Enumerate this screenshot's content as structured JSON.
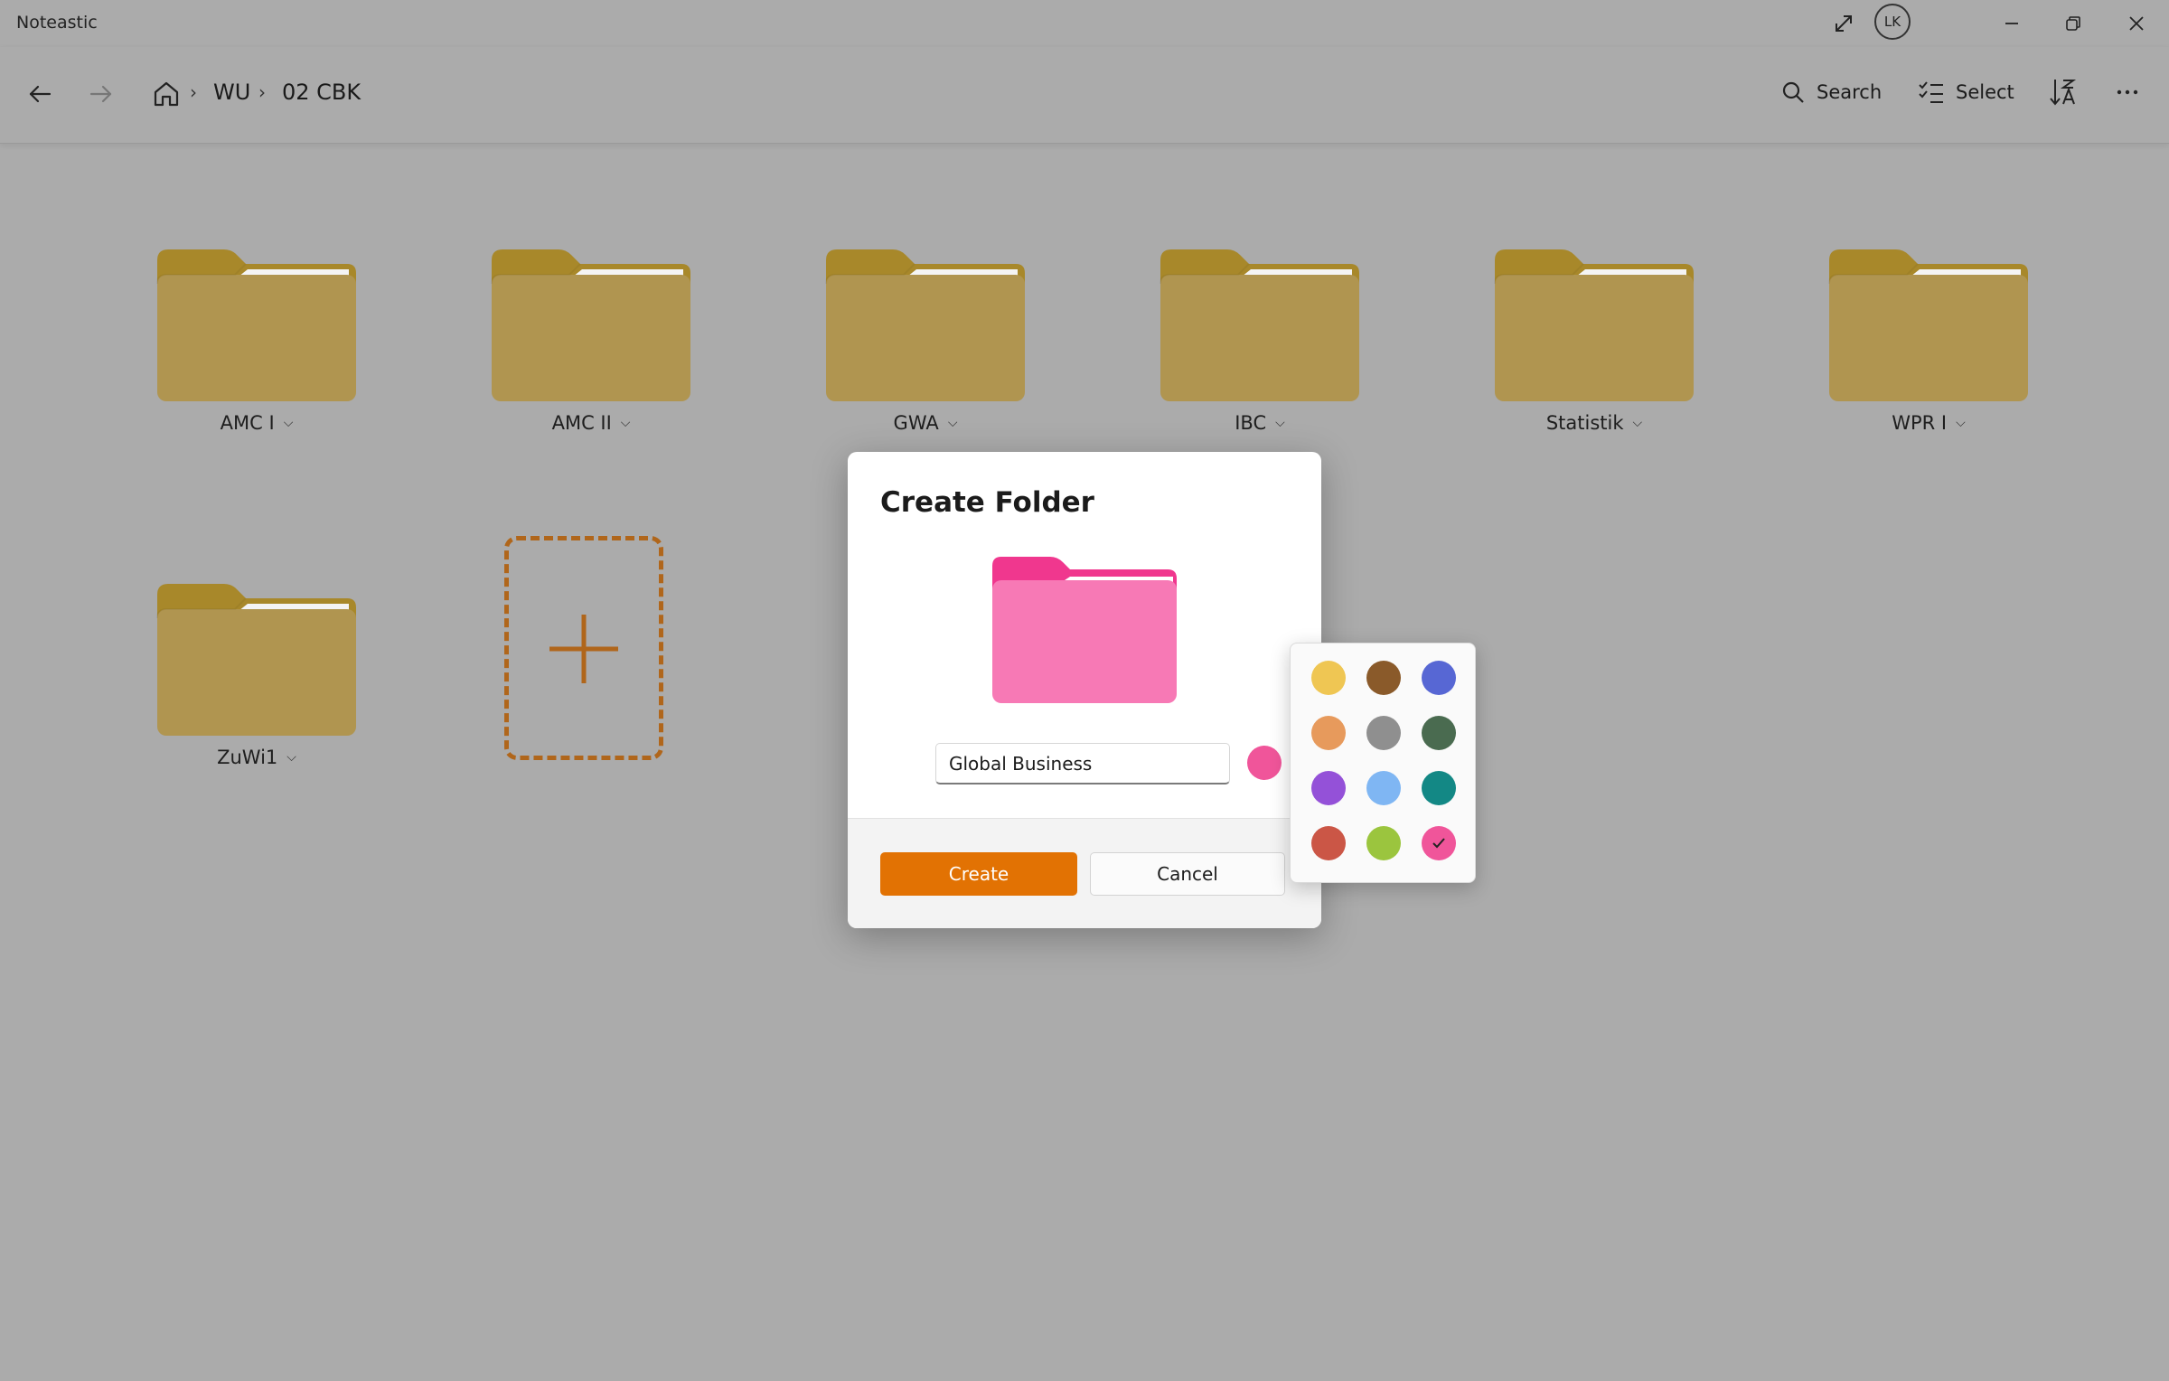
{
  "app": {
    "title": "Noteastic",
    "avatar_initials": "LK"
  },
  "breadcrumb": {
    "items": [
      "WU",
      "02 CBK"
    ]
  },
  "toolbar": {
    "search_label": "Search",
    "select_label": "Select"
  },
  "folders": [
    {
      "name": "AMC I"
    },
    {
      "name": "AMC II"
    },
    {
      "name": "GWA"
    },
    {
      "name": "IBC"
    },
    {
      "name": "Statistik"
    },
    {
      "name": "WPR I"
    },
    {
      "name": "ZuWi1"
    }
  ],
  "dialog": {
    "title": "Create Folder",
    "name_value": "Global Business",
    "selected_color": "#f0559a",
    "create_label": "Create",
    "cancel_label": "Cancel"
  },
  "colors": {
    "folder_default": "#b09550",
    "folder_tab": "#a8882a",
    "accent": "#e27203",
    "preview_body": "#f779b5",
    "preview_tab": "#f0378e"
  },
  "palette": [
    {
      "name": "yellow",
      "hex": "#efc653"
    },
    {
      "name": "brown",
      "hex": "#8a5a2a"
    },
    {
      "name": "blue",
      "hex": "#5767d4"
    },
    {
      "name": "orange",
      "hex": "#e79a5c"
    },
    {
      "name": "gray",
      "hex": "#8f8f8f"
    },
    {
      "name": "dark-green",
      "hex": "#4a6b50"
    },
    {
      "name": "purple",
      "hex": "#9451d8"
    },
    {
      "name": "light-blue",
      "hex": "#7fb6f3"
    },
    {
      "name": "teal",
      "hex": "#138885"
    },
    {
      "name": "red",
      "hex": "#cb5646"
    },
    {
      "name": "lime",
      "hex": "#9bc53e"
    },
    {
      "name": "pink",
      "hex": "#f0559a",
      "selected": true
    }
  ]
}
